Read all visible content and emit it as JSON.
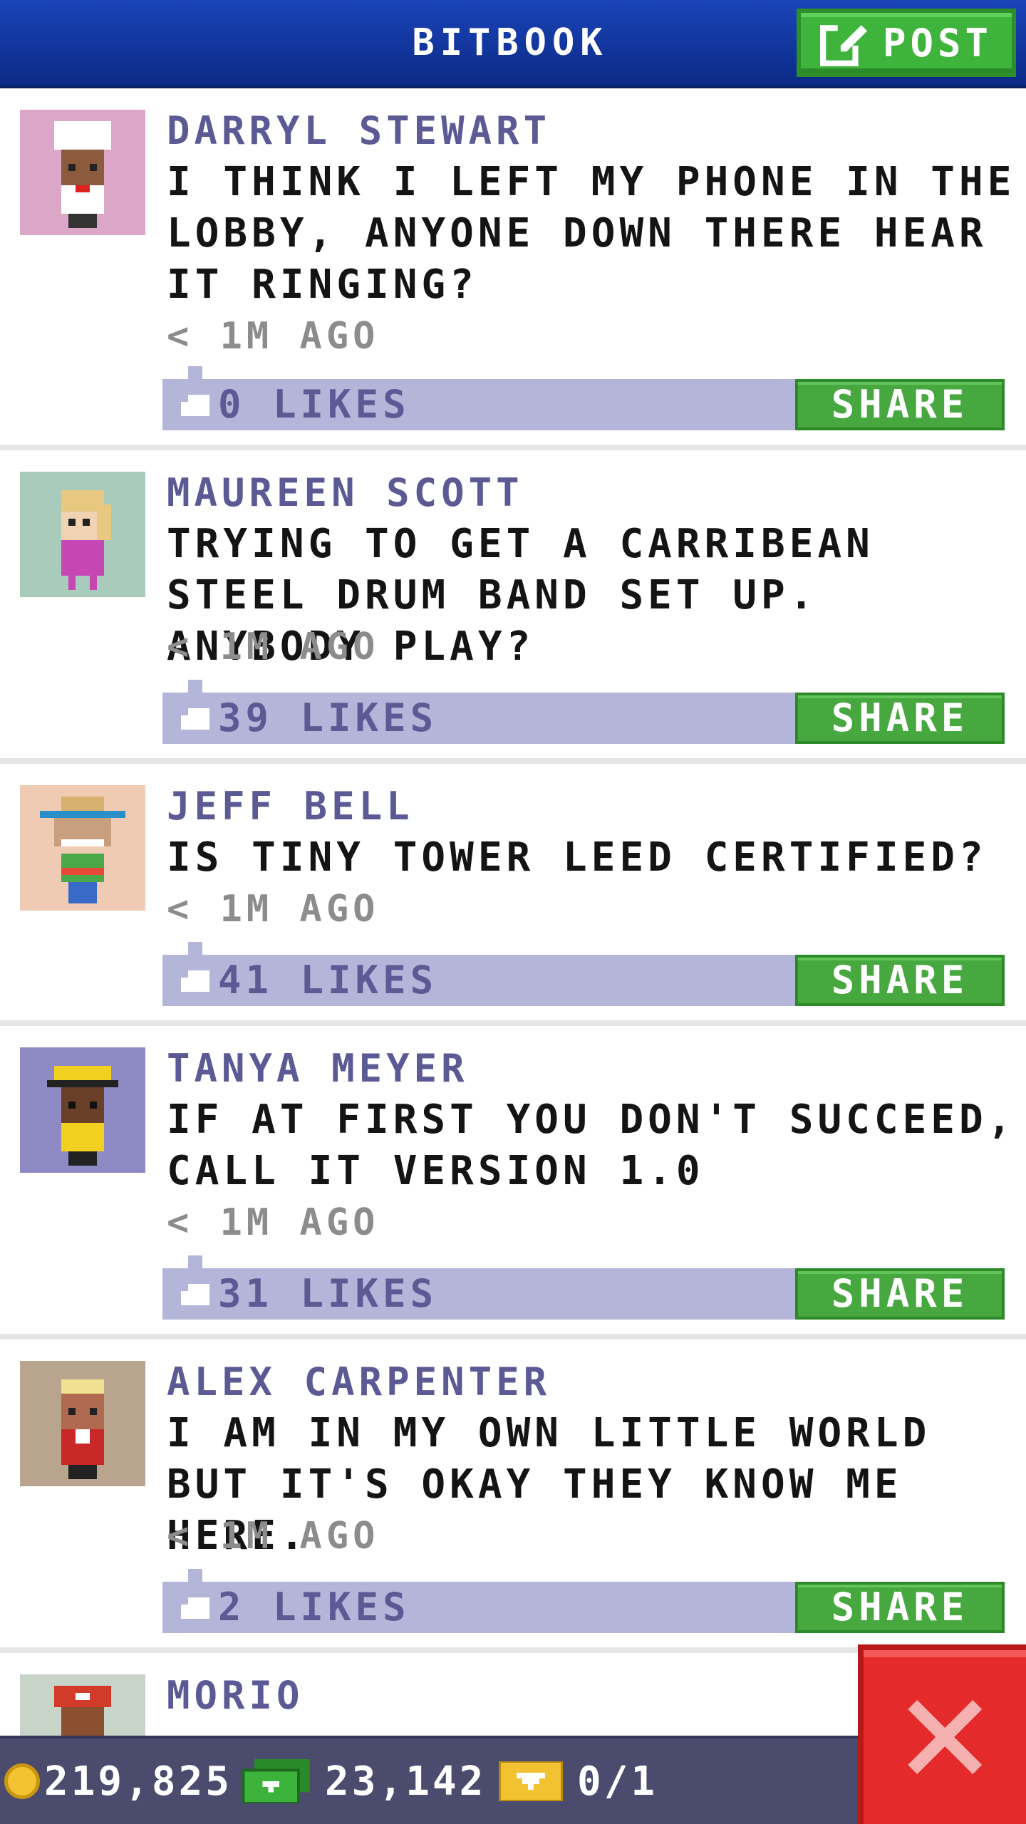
{
  "header": {
    "title": "BITBOOK",
    "post_label": "POST",
    "post_icon": "edit-icon"
  },
  "colors": {
    "header_blue": "#1a44b9",
    "author_purple": "#5b5a95",
    "like_bar": "#b4b6d9",
    "share_green": "#46a83f",
    "close_red": "#e42a2a",
    "footer": "#4b4b6e"
  },
  "posts": [
    {
      "author": "DARRYL STEWART",
      "message": "I THINK I LEFT MY PHONE IN THE LOBBY, ANYONE DOWN THERE HEAR IT RINGING?",
      "time": "< 1M AGO",
      "likes": "0 LIKES",
      "share": "SHARE",
      "avatar_bg": "#dca6c8"
    },
    {
      "author": "MAUREEN SCOTT",
      "message": "TRYING TO GET A CARRIBEAN STEEL DRUM BAND SET UP. ANYBODY PLAY?",
      "time": "< 1M AGO",
      "likes": "39 LIKES",
      "share": "SHARE",
      "avatar_bg": "#a9cbbb"
    },
    {
      "author": "JEFF BELL",
      "message": "IS TINY TOWER LEED CERTIFIED?",
      "time": "< 1M AGO",
      "likes": "41 LIKES",
      "share": "SHARE",
      "avatar_bg": "#efcbb4"
    },
    {
      "author": "TANYA MEYER",
      "message": "IF AT FIRST YOU DON'T SUCCEED, CALL IT VERSION 1.0",
      "time": "< 1M AGO",
      "likes": "31 LIKES",
      "share": "SHARE",
      "avatar_bg": "#8e8ac3"
    },
    {
      "author": "ALEX CARPENTER",
      "message": "I AM IN MY OWN LITTLE WORLD BUT IT'S OKAY THEY KNOW ME HERE.",
      "time": "< 1M AGO",
      "likes": "2 LIKES",
      "share": "SHARE",
      "avatar_bg": "#b9a58e"
    },
    {
      "author": "MORIO",
      "message": "",
      "time": "",
      "likes": "",
      "share": "",
      "avatar_bg": "#c9d4c8"
    }
  ],
  "footer": {
    "coins": "219,825",
    "bux": "23,142",
    "tickets": "0/1"
  },
  "close_icon": "close-icon"
}
